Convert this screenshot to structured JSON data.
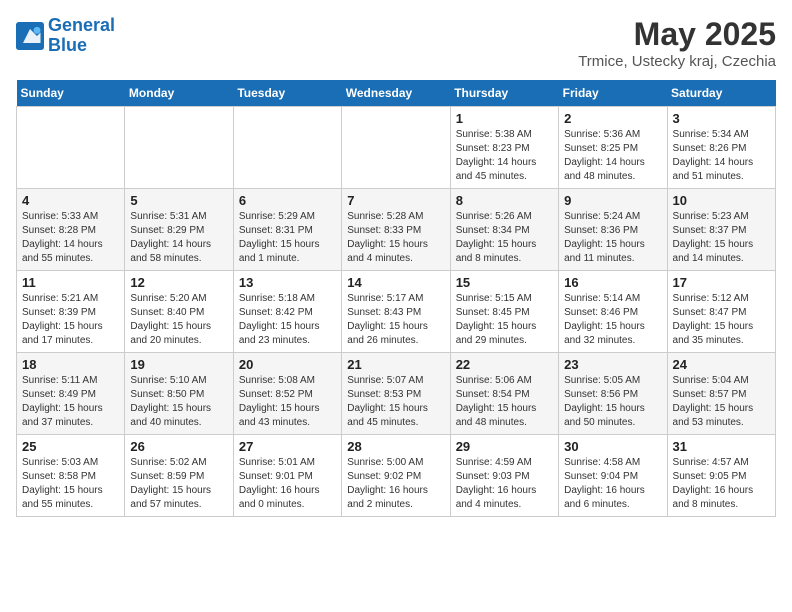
{
  "header": {
    "logo_line1": "General",
    "logo_line2": "Blue",
    "month": "May 2025",
    "location": "Trmice, Ustecky kraj, Czechia"
  },
  "weekdays": [
    "Sunday",
    "Monday",
    "Tuesday",
    "Wednesday",
    "Thursday",
    "Friday",
    "Saturday"
  ],
  "weeks": [
    [
      {
        "day": "",
        "info": ""
      },
      {
        "day": "",
        "info": ""
      },
      {
        "day": "",
        "info": ""
      },
      {
        "day": "",
        "info": ""
      },
      {
        "day": "1",
        "info": "Sunrise: 5:38 AM\nSunset: 8:23 PM\nDaylight: 14 hours\nand 45 minutes."
      },
      {
        "day": "2",
        "info": "Sunrise: 5:36 AM\nSunset: 8:25 PM\nDaylight: 14 hours\nand 48 minutes."
      },
      {
        "day": "3",
        "info": "Sunrise: 5:34 AM\nSunset: 8:26 PM\nDaylight: 14 hours\nand 51 minutes."
      }
    ],
    [
      {
        "day": "4",
        "info": "Sunrise: 5:33 AM\nSunset: 8:28 PM\nDaylight: 14 hours\nand 55 minutes."
      },
      {
        "day": "5",
        "info": "Sunrise: 5:31 AM\nSunset: 8:29 PM\nDaylight: 14 hours\nand 58 minutes."
      },
      {
        "day": "6",
        "info": "Sunrise: 5:29 AM\nSunset: 8:31 PM\nDaylight: 15 hours\nand 1 minute."
      },
      {
        "day": "7",
        "info": "Sunrise: 5:28 AM\nSunset: 8:33 PM\nDaylight: 15 hours\nand 4 minutes."
      },
      {
        "day": "8",
        "info": "Sunrise: 5:26 AM\nSunset: 8:34 PM\nDaylight: 15 hours\nand 8 minutes."
      },
      {
        "day": "9",
        "info": "Sunrise: 5:24 AM\nSunset: 8:36 PM\nDaylight: 15 hours\nand 11 minutes."
      },
      {
        "day": "10",
        "info": "Sunrise: 5:23 AM\nSunset: 8:37 PM\nDaylight: 15 hours\nand 14 minutes."
      }
    ],
    [
      {
        "day": "11",
        "info": "Sunrise: 5:21 AM\nSunset: 8:39 PM\nDaylight: 15 hours\nand 17 minutes."
      },
      {
        "day": "12",
        "info": "Sunrise: 5:20 AM\nSunset: 8:40 PM\nDaylight: 15 hours\nand 20 minutes."
      },
      {
        "day": "13",
        "info": "Sunrise: 5:18 AM\nSunset: 8:42 PM\nDaylight: 15 hours\nand 23 minutes."
      },
      {
        "day": "14",
        "info": "Sunrise: 5:17 AM\nSunset: 8:43 PM\nDaylight: 15 hours\nand 26 minutes."
      },
      {
        "day": "15",
        "info": "Sunrise: 5:15 AM\nSunset: 8:45 PM\nDaylight: 15 hours\nand 29 minutes."
      },
      {
        "day": "16",
        "info": "Sunrise: 5:14 AM\nSunset: 8:46 PM\nDaylight: 15 hours\nand 32 minutes."
      },
      {
        "day": "17",
        "info": "Sunrise: 5:12 AM\nSunset: 8:47 PM\nDaylight: 15 hours\nand 35 minutes."
      }
    ],
    [
      {
        "day": "18",
        "info": "Sunrise: 5:11 AM\nSunset: 8:49 PM\nDaylight: 15 hours\nand 37 minutes."
      },
      {
        "day": "19",
        "info": "Sunrise: 5:10 AM\nSunset: 8:50 PM\nDaylight: 15 hours\nand 40 minutes."
      },
      {
        "day": "20",
        "info": "Sunrise: 5:08 AM\nSunset: 8:52 PM\nDaylight: 15 hours\nand 43 minutes."
      },
      {
        "day": "21",
        "info": "Sunrise: 5:07 AM\nSunset: 8:53 PM\nDaylight: 15 hours\nand 45 minutes."
      },
      {
        "day": "22",
        "info": "Sunrise: 5:06 AM\nSunset: 8:54 PM\nDaylight: 15 hours\nand 48 minutes."
      },
      {
        "day": "23",
        "info": "Sunrise: 5:05 AM\nSunset: 8:56 PM\nDaylight: 15 hours\nand 50 minutes."
      },
      {
        "day": "24",
        "info": "Sunrise: 5:04 AM\nSunset: 8:57 PM\nDaylight: 15 hours\nand 53 minutes."
      }
    ],
    [
      {
        "day": "25",
        "info": "Sunrise: 5:03 AM\nSunset: 8:58 PM\nDaylight: 15 hours\nand 55 minutes."
      },
      {
        "day": "26",
        "info": "Sunrise: 5:02 AM\nSunset: 8:59 PM\nDaylight: 15 hours\nand 57 minutes."
      },
      {
        "day": "27",
        "info": "Sunrise: 5:01 AM\nSunset: 9:01 PM\nDaylight: 16 hours\nand 0 minutes."
      },
      {
        "day": "28",
        "info": "Sunrise: 5:00 AM\nSunset: 9:02 PM\nDaylight: 16 hours\nand 2 minutes."
      },
      {
        "day": "29",
        "info": "Sunrise: 4:59 AM\nSunset: 9:03 PM\nDaylight: 16 hours\nand 4 minutes."
      },
      {
        "day": "30",
        "info": "Sunrise: 4:58 AM\nSunset: 9:04 PM\nDaylight: 16 hours\nand 6 minutes."
      },
      {
        "day": "31",
        "info": "Sunrise: 4:57 AM\nSunset: 9:05 PM\nDaylight: 16 hours\nand 8 minutes."
      }
    ]
  ]
}
